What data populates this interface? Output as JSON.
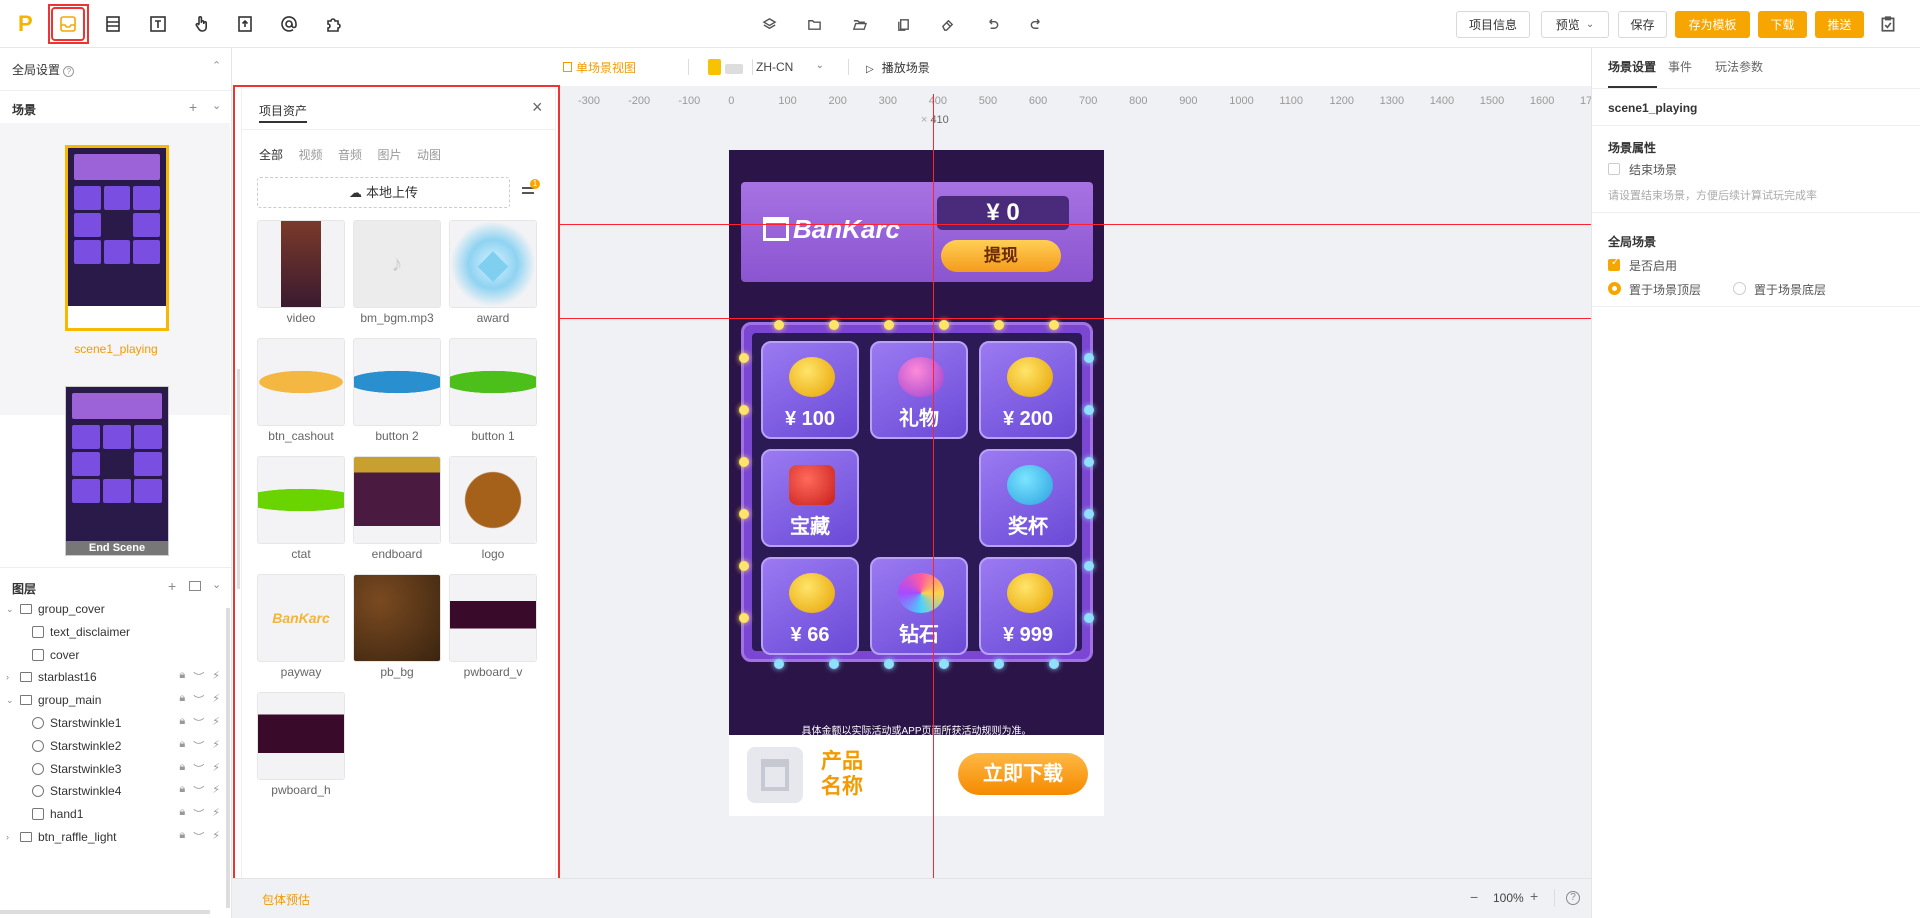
{
  "toolbar": {
    "logo": "P",
    "project_info": "项目信息",
    "preview": "预览",
    "save": "保存",
    "save_template": "存为模板",
    "download": "下载",
    "push": "推送"
  },
  "left": {
    "global_settings": "全局设置",
    "scenes_title": "场景",
    "scenes": [
      {
        "name": "scene1_playing"
      },
      {
        "name": "End Scene"
      }
    ],
    "layers_title": "图层",
    "layers": [
      {
        "name": "group_cover",
        "type": "folder",
        "expanded": true
      },
      {
        "name": "text_disclaimer",
        "type": "text"
      },
      {
        "name": "cover",
        "type": "image"
      },
      {
        "name": "starblast16",
        "type": "folder",
        "expanded": false
      },
      {
        "name": "group_main",
        "type": "folder",
        "expanded": true
      },
      {
        "name": "Starstwinkle1",
        "type": "particle"
      },
      {
        "name": "Starstwinkle2",
        "type": "particle"
      },
      {
        "name": "Starstwinkle3",
        "type": "particle"
      },
      {
        "name": "Starstwinkle4",
        "type": "particle"
      },
      {
        "name": "hand1",
        "type": "image"
      },
      {
        "name": "btn_raffle_light",
        "type": "folder",
        "expanded": false
      }
    ]
  },
  "canvas_bar": {
    "view_mode": "单场景视图",
    "language": "ZH-CN",
    "play": "播放场景"
  },
  "ruler": {
    "ticks": [
      "-300",
      "-200",
      "-100",
      "0",
      "100",
      "200",
      "300",
      "400",
      "500",
      "600",
      "700",
      "800",
      "900",
      "1000",
      "1100",
      "1200",
      "1300",
      "1400",
      "1500",
      "1600",
      "17"
    ],
    "guide_value": "410"
  },
  "assets": {
    "title": "项目资产",
    "filters": [
      "全部",
      "视频",
      "音频",
      "图片",
      "动图"
    ],
    "upload": "本地上传",
    "filter_badge": "1",
    "items": [
      {
        "name": "video"
      },
      {
        "name": "bm_bgm.mp3"
      },
      {
        "name": "award"
      },
      {
        "name": "btn_cashout"
      },
      {
        "name": "button 2"
      },
      {
        "name": "button 1"
      },
      {
        "name": "ctat"
      },
      {
        "name": "endboard"
      },
      {
        "name": "logo"
      },
      {
        "name": "payway",
        "text": "BanKarc"
      },
      {
        "name": "pb_bg"
      },
      {
        "name": "pwboard_v"
      },
      {
        "name": "pwboard_h"
      }
    ]
  },
  "phone": {
    "brand": "BanKarc",
    "balance": "¥ 0",
    "cashout": "提现",
    "cells": [
      "¥ 100",
      "礼物",
      "¥ 200",
      "宝藏",
      "",
      "奖杯",
      "¥ 66",
      "钻石",
      "¥ 999"
    ],
    "disclaimer": "具体金额以实际活动或APP页面所获活动规则为准。",
    "app_name": "产品名称",
    "download": "立即下载"
  },
  "status": {
    "package_estimate": "包体预估",
    "zoom": "100%"
  },
  "right": {
    "tabs": [
      "场景设置",
      "事件",
      "玩法参数"
    ],
    "scene_name": "scene1_playing",
    "scene_props": "场景属性",
    "end_scene": "结束场景",
    "end_hint": "请设置结束场景，方便后续计算试玩完成率",
    "global_scene": "全局场景",
    "enable": "是否启用",
    "top": "置于场景顶层",
    "bottom": "置于场景底层"
  },
  "colors": {
    "accent": "#f7a500",
    "highlight": "#e33333",
    "guide": "#ff2a3a"
  }
}
